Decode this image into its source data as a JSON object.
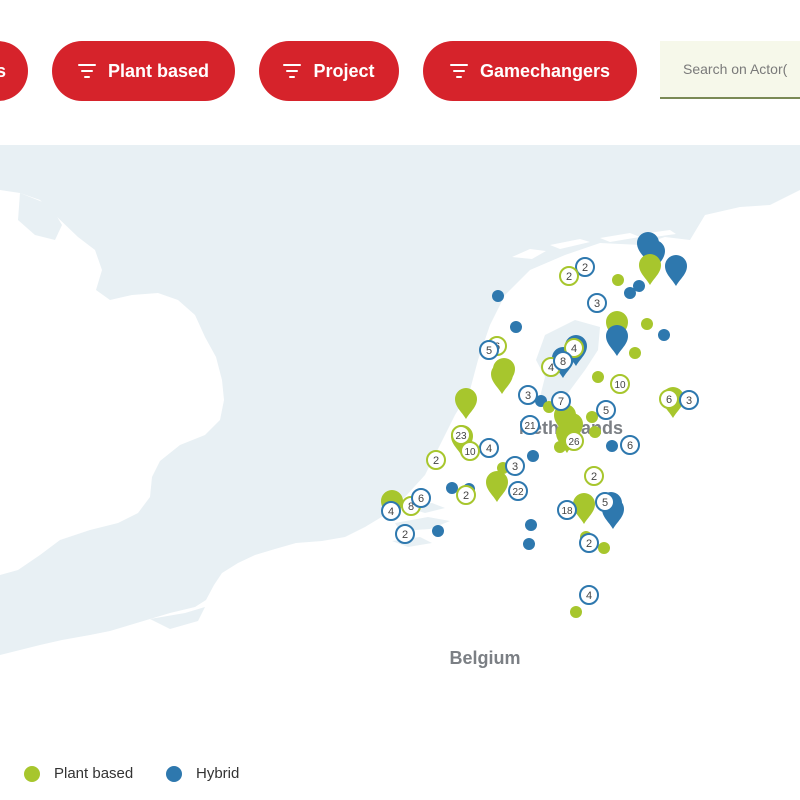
{
  "filters": {
    "items": [
      {
        "label": "s"
      },
      {
        "label": "Plant based"
      },
      {
        "label": "Project"
      },
      {
        "label": "Gamechangers"
      }
    ],
    "search_placeholder": "Search on Actor("
  },
  "map": {
    "labels": {
      "netherlands": "Netherlands",
      "belgium": "Belgium"
    }
  },
  "legend": {
    "items": [
      {
        "label": "Plant based",
        "color": "#a7c62d"
      },
      {
        "label": "Hybrid",
        "color": "#2e78ae"
      }
    ]
  },
  "colors": {
    "accent": "#d6232b",
    "plant_based": "#a7c62d",
    "hybrid": "#2e78ae",
    "sea": "#e8f0f4",
    "land": "#ffffff"
  },
  "clusters": [
    {
      "type": "hybrid",
      "count": "2"
    },
    {
      "type": "plant",
      "count": "2"
    },
    {
      "type": "hybrid",
      "count": "3"
    },
    {
      "type": "plant",
      "count": "6"
    },
    {
      "type": "hybrid",
      "count": "5"
    },
    {
      "type": "plant",
      "count": "4"
    },
    {
      "type": "plant",
      "count": "4"
    },
    {
      "type": "hybrid",
      "count": "8"
    },
    {
      "type": "plant",
      "count": "10"
    },
    {
      "type": "hybrid",
      "count": "3"
    },
    {
      "type": "hybrid",
      "count": "7"
    },
    {
      "type": "hybrid",
      "count": "5"
    },
    {
      "type": "plant",
      "count": "6"
    },
    {
      "type": "hybrid",
      "count": "3"
    },
    {
      "type": "hybrid",
      "count": "21"
    },
    {
      "type": "plant",
      "count": "23"
    },
    {
      "type": "hybrid",
      "count": "4"
    },
    {
      "type": "hybrid",
      "count": "6"
    },
    {
      "type": "plant",
      "count": "26"
    },
    {
      "type": "plant",
      "count": "2"
    },
    {
      "type": "plant",
      "count": "10"
    },
    {
      "type": "hybrid",
      "count": "3"
    },
    {
      "type": "plant",
      "count": "2"
    },
    {
      "type": "plant",
      "count": "2"
    },
    {
      "type": "hybrid",
      "count": "22"
    },
    {
      "type": "hybrid",
      "count": "5"
    },
    {
      "type": "hybrid",
      "count": "18"
    },
    {
      "type": "hybrid",
      "count": "4"
    },
    {
      "type": "plant",
      "count": "8"
    },
    {
      "type": "hybrid",
      "count": "6"
    },
    {
      "type": "hybrid",
      "count": "2"
    },
    {
      "type": "hybrid",
      "count": "2"
    },
    {
      "type": "hybrid",
      "count": "4"
    }
  ],
  "pins": [
    {
      "type": "hybrid"
    },
    {
      "type": "hybrid"
    },
    {
      "type": "plant"
    },
    {
      "type": "hybrid"
    },
    {
      "type": "plant"
    },
    {
      "type": "hybrid"
    },
    {
      "type": "hybrid"
    },
    {
      "type": "hybrid"
    },
    {
      "type": "plant"
    },
    {
      "type": "plant"
    },
    {
      "type": "plant"
    },
    {
      "type": "plant"
    },
    {
      "type": "plant"
    },
    {
      "type": "plant"
    },
    {
      "type": "plant"
    },
    {
      "type": "plant"
    },
    {
      "type": "plant"
    },
    {
      "type": "plant"
    },
    {
      "type": "hybrid"
    },
    {
      "type": "hybrid"
    },
    {
      "type": "plant"
    }
  ],
  "dots": [
    {
      "type": "hybrid"
    },
    {
      "type": "hybrid"
    },
    {
      "type": "hybrid"
    },
    {
      "type": "plant"
    },
    {
      "type": "plant"
    },
    {
      "type": "hybrid"
    },
    {
      "type": "plant"
    },
    {
      "type": "plant"
    },
    {
      "type": "hybrid"
    },
    {
      "type": "plant"
    },
    {
      "type": "plant"
    },
    {
      "type": "hybrid"
    },
    {
      "type": "plant"
    },
    {
      "type": "hybrid"
    },
    {
      "type": "plant"
    },
    {
      "type": "hybrid"
    },
    {
      "type": "hybrid"
    },
    {
      "type": "hybrid"
    },
    {
      "type": "hybrid"
    },
    {
      "type": "plant"
    },
    {
      "type": "plant"
    },
    {
      "type": "plant"
    },
    {
      "type": "plant"
    },
    {
      "type": "hybrid"
    },
    {
      "type": "plant"
    },
    {
      "type": "hybrid"
    }
  ]
}
